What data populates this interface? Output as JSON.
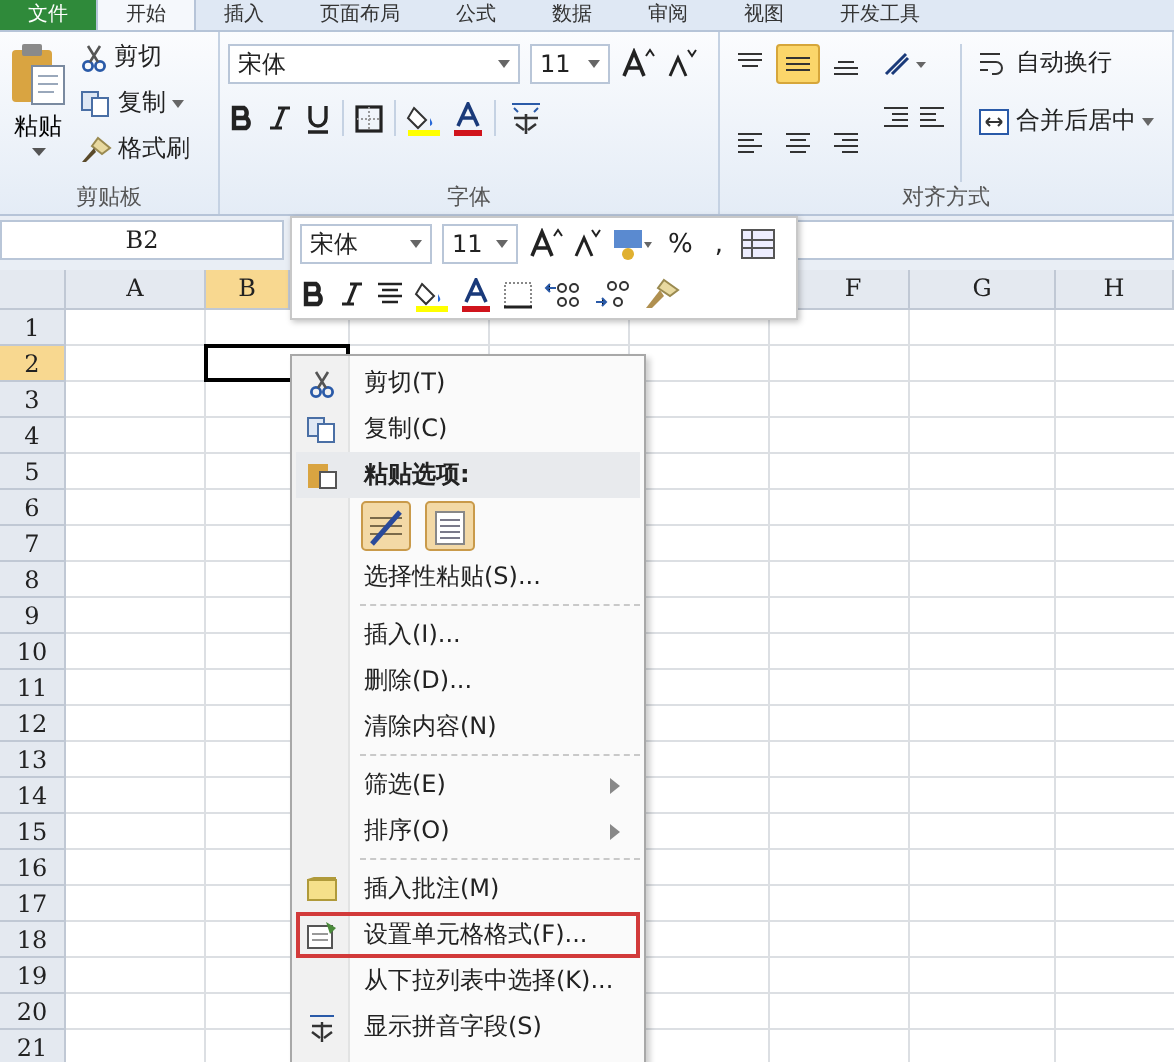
{
  "tabs": [
    {
      "label": "文件",
      "selected": false
    },
    {
      "label": "开始",
      "selected": true
    },
    {
      "label": "插入",
      "selected": false
    },
    {
      "label": "页面布局",
      "selected": false
    },
    {
      "label": "公式",
      "selected": false
    },
    {
      "label": "数据",
      "selected": false
    },
    {
      "label": "审阅",
      "selected": false
    },
    {
      "label": "视图",
      "selected": false
    },
    {
      "label": "开发工具",
      "selected": false
    }
  ],
  "clipboard": {
    "paste": "粘贴",
    "cut": "剪切",
    "copy": "复制",
    "format_painter": "格式刷",
    "label": "剪贴板"
  },
  "font": {
    "name": "宋体",
    "size": "11",
    "label": "字体"
  },
  "alignment": {
    "buttons": [
      {
        "kind": "top",
        "selected": false
      },
      {
        "kind": "middle",
        "selected": true
      },
      {
        "kind": "bottom",
        "selected": false
      },
      {
        "kind": "left",
        "selected": false
      },
      {
        "kind": "center",
        "selected": false
      },
      {
        "kind": "right",
        "selected": false
      }
    ],
    "wrap": "自动换行",
    "merge": "合并后居中",
    "label": "对齐方式"
  },
  "name_box": "B2",
  "columns": [
    {
      "label": "A",
      "selected": false
    },
    {
      "label": "B",
      "selected": true
    },
    {
      "label": "F",
      "selected": false
    },
    {
      "label": "G",
      "selected": false
    },
    {
      "label": "H",
      "selected": false
    }
  ],
  "rows": [
    {
      "label": "1",
      "selected": false
    },
    {
      "label": "2",
      "selected": true
    },
    {
      "label": "3",
      "selected": false
    },
    {
      "label": "4",
      "selected": false
    },
    {
      "label": "5",
      "selected": false
    },
    {
      "label": "6",
      "selected": false
    },
    {
      "label": "7",
      "selected": false
    },
    {
      "label": "8",
      "selected": false
    },
    {
      "label": "9",
      "selected": false
    },
    {
      "label": "10",
      "selected": false
    },
    {
      "label": "11",
      "selected": false
    },
    {
      "label": "12",
      "selected": false
    },
    {
      "label": "13",
      "selected": false
    },
    {
      "label": "14",
      "selected": false
    },
    {
      "label": "15",
      "selected": false
    },
    {
      "label": "16",
      "selected": false
    },
    {
      "label": "17",
      "selected": false
    },
    {
      "label": "18",
      "selected": false
    },
    {
      "label": "19",
      "selected": false
    },
    {
      "label": "20",
      "selected": false
    },
    {
      "label": "21",
      "selected": false
    }
  ],
  "mini_toolbar": {
    "font": "宋体",
    "size": "11",
    "percent": "%",
    "comma": ","
  },
  "context_menu": {
    "items": [
      {
        "kind": "cut",
        "label": "剪切(T)",
        "submenu": false,
        "highlighted": false
      },
      {
        "kind": "copy",
        "label": "复制(C)",
        "submenu": false,
        "highlighted": false
      },
      {
        "kind": "pasteheader",
        "label": "粘贴选项:",
        "submenu": false,
        "highlighted": false
      },
      {
        "kind": "pastebuttons"
      },
      {
        "kind": "plain",
        "label": "选择性粘贴(S)...",
        "submenu": false,
        "highlighted": false
      },
      {
        "kind": "separator"
      },
      {
        "kind": "plain",
        "label": "插入(I)...",
        "submenu": false,
        "highlighted": false
      },
      {
        "kind": "plain",
        "label": "删除(D)...",
        "submenu": false,
        "highlighted": false
      },
      {
        "kind": "plain",
        "label": "清除内容(N)",
        "submenu": false,
        "highlighted": false
      },
      {
        "kind": "separator"
      },
      {
        "kind": "plain",
        "label": "筛选(E)",
        "submenu": true,
        "highlighted": false
      },
      {
        "kind": "plain",
        "label": "排序(O)",
        "submenu": true,
        "highlighted": false
      },
      {
        "kind": "separator"
      },
      {
        "kind": "comment",
        "label": "插入批注(M)",
        "submenu": false,
        "highlighted": false
      },
      {
        "kind": "format",
        "label": "设置单元格格式(F)...",
        "submenu": false,
        "highlighted": true
      },
      {
        "kind": "plain",
        "label": "从下拉列表中选择(K)...",
        "submenu": false,
        "highlighted": false
      },
      {
        "kind": "phonetic",
        "label": "显示拼音字段(S)",
        "submenu": false,
        "highlighted": false
      }
    ]
  }
}
